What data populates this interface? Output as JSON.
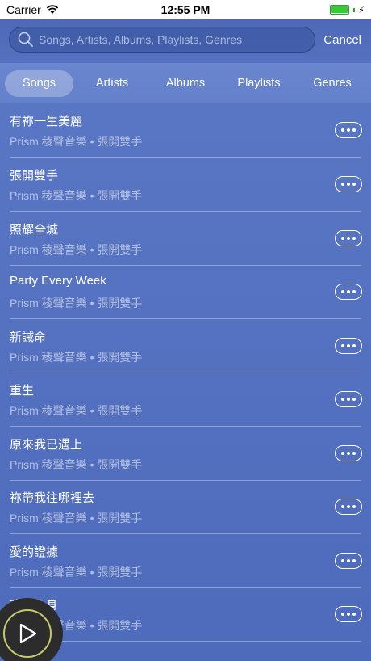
{
  "status_bar": {
    "carrier": "Carrier",
    "time": "12:55 PM"
  },
  "search": {
    "placeholder": "Songs, Artists, Albums, Playlists, Genres",
    "value": "",
    "cancel_label": "Cancel"
  },
  "tabs": [
    {
      "label": "Songs",
      "active": true
    },
    {
      "label": "Artists",
      "active": false
    },
    {
      "label": "Albums",
      "active": false
    },
    {
      "label": "Playlists",
      "active": false
    },
    {
      "label": "Genres",
      "active": false
    }
  ],
  "songs": [
    {
      "title": "有祢一生美麗",
      "artist": "Prism 稜聲音樂",
      "album": "張開雙手"
    },
    {
      "title": "張開雙手",
      "artist": "Prism 稜聲音樂",
      "album": "張開雙手"
    },
    {
      "title": "照耀全城",
      "artist": "Prism 稜聲音樂",
      "album": "張開雙手"
    },
    {
      "title": "Party Every Week",
      "artist": "Prism 稜聲音樂",
      "album": "張開雙手"
    },
    {
      "title": "新誡命",
      "artist": "Prism 稜聲音樂",
      "album": "張開雙手"
    },
    {
      "title": "重生",
      "artist": "Prism 稜聲音樂",
      "album": "張開雙手"
    },
    {
      "title": "原來我已遇上",
      "artist": "Prism 稜聲音樂",
      "album": "張開雙手"
    },
    {
      "title": "祢帶我往哪裡去",
      "artist": "Prism 稜聲音樂",
      "album": "張開雙手"
    },
    {
      "title": "愛的證據",
      "artist": "Prism 稜聲音樂",
      "album": "張開雙手"
    },
    {
      "title": "我要全身",
      "artist": "Prism 稜聲音樂",
      "album": "張開雙手"
    }
  ],
  "separator": "•",
  "icons": {
    "wifi": "wifi-icon",
    "battery": "battery-icon",
    "search": "search-icon",
    "more": "more-icon",
    "play": "play-icon"
  },
  "colors": {
    "background": "#5673c2",
    "accent": "#ffffff",
    "player_ring": "#c8c86a"
  }
}
